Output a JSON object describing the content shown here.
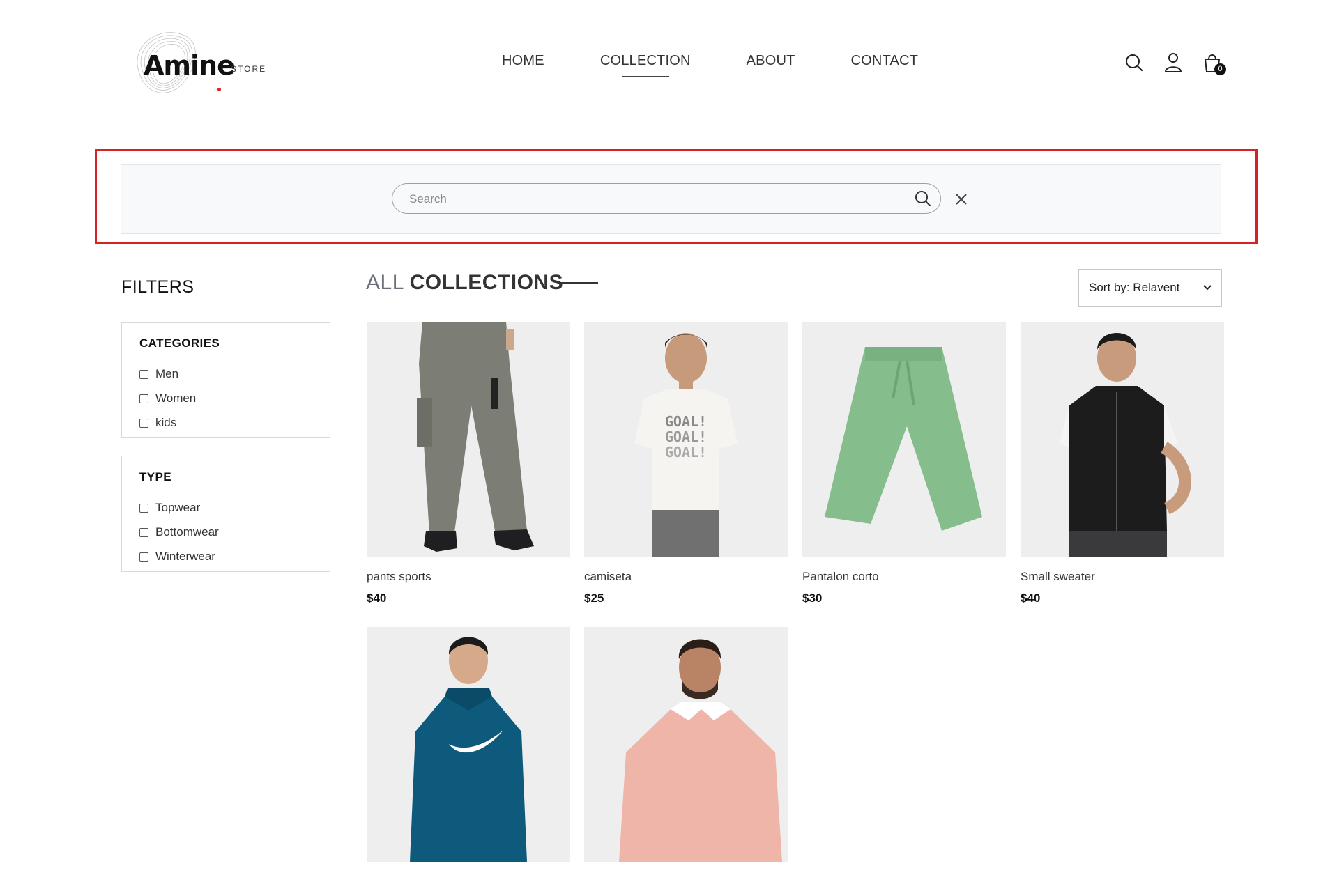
{
  "brand": {
    "name": "Amine",
    "tagline": "STORE"
  },
  "nav": {
    "items": [
      {
        "label": "HOME"
      },
      {
        "label": "COLLECTION"
      },
      {
        "label": "ABOUT"
      },
      {
        "label": "CONTACT"
      }
    ],
    "active": "COLLECTION",
    "icons": [
      "search-icon",
      "user-icon",
      "cart-icon"
    ],
    "cart_count": "0"
  },
  "search": {
    "placeholder": "Search",
    "value": ""
  },
  "filters": {
    "title": "FILTERS",
    "categories": {
      "heading": "CATEGORIES",
      "options": [
        "Men",
        "Women",
        "kids"
      ]
    },
    "type": {
      "heading": "TYPE",
      "options": [
        "Topwear",
        "Bottomwear",
        "Winterwear"
      ]
    }
  },
  "collections": {
    "title_light": "ALL",
    "title_bold": "COLLECTIONS",
    "sort_label": "Sort by: Relavent",
    "products": [
      {
        "name": "pants sports",
        "price": "$40"
      },
      {
        "name": "camiseta",
        "price": "$25"
      },
      {
        "name": "Pantalon corto",
        "price": "$30"
      },
      {
        "name": "Small sweater",
        "price": "$40"
      },
      {
        "name": "",
        "price": ""
      },
      {
        "name": "",
        "price": ""
      }
    ]
  },
  "colors": {
    "highlight": "#d62222",
    "accent": "#111111"
  }
}
